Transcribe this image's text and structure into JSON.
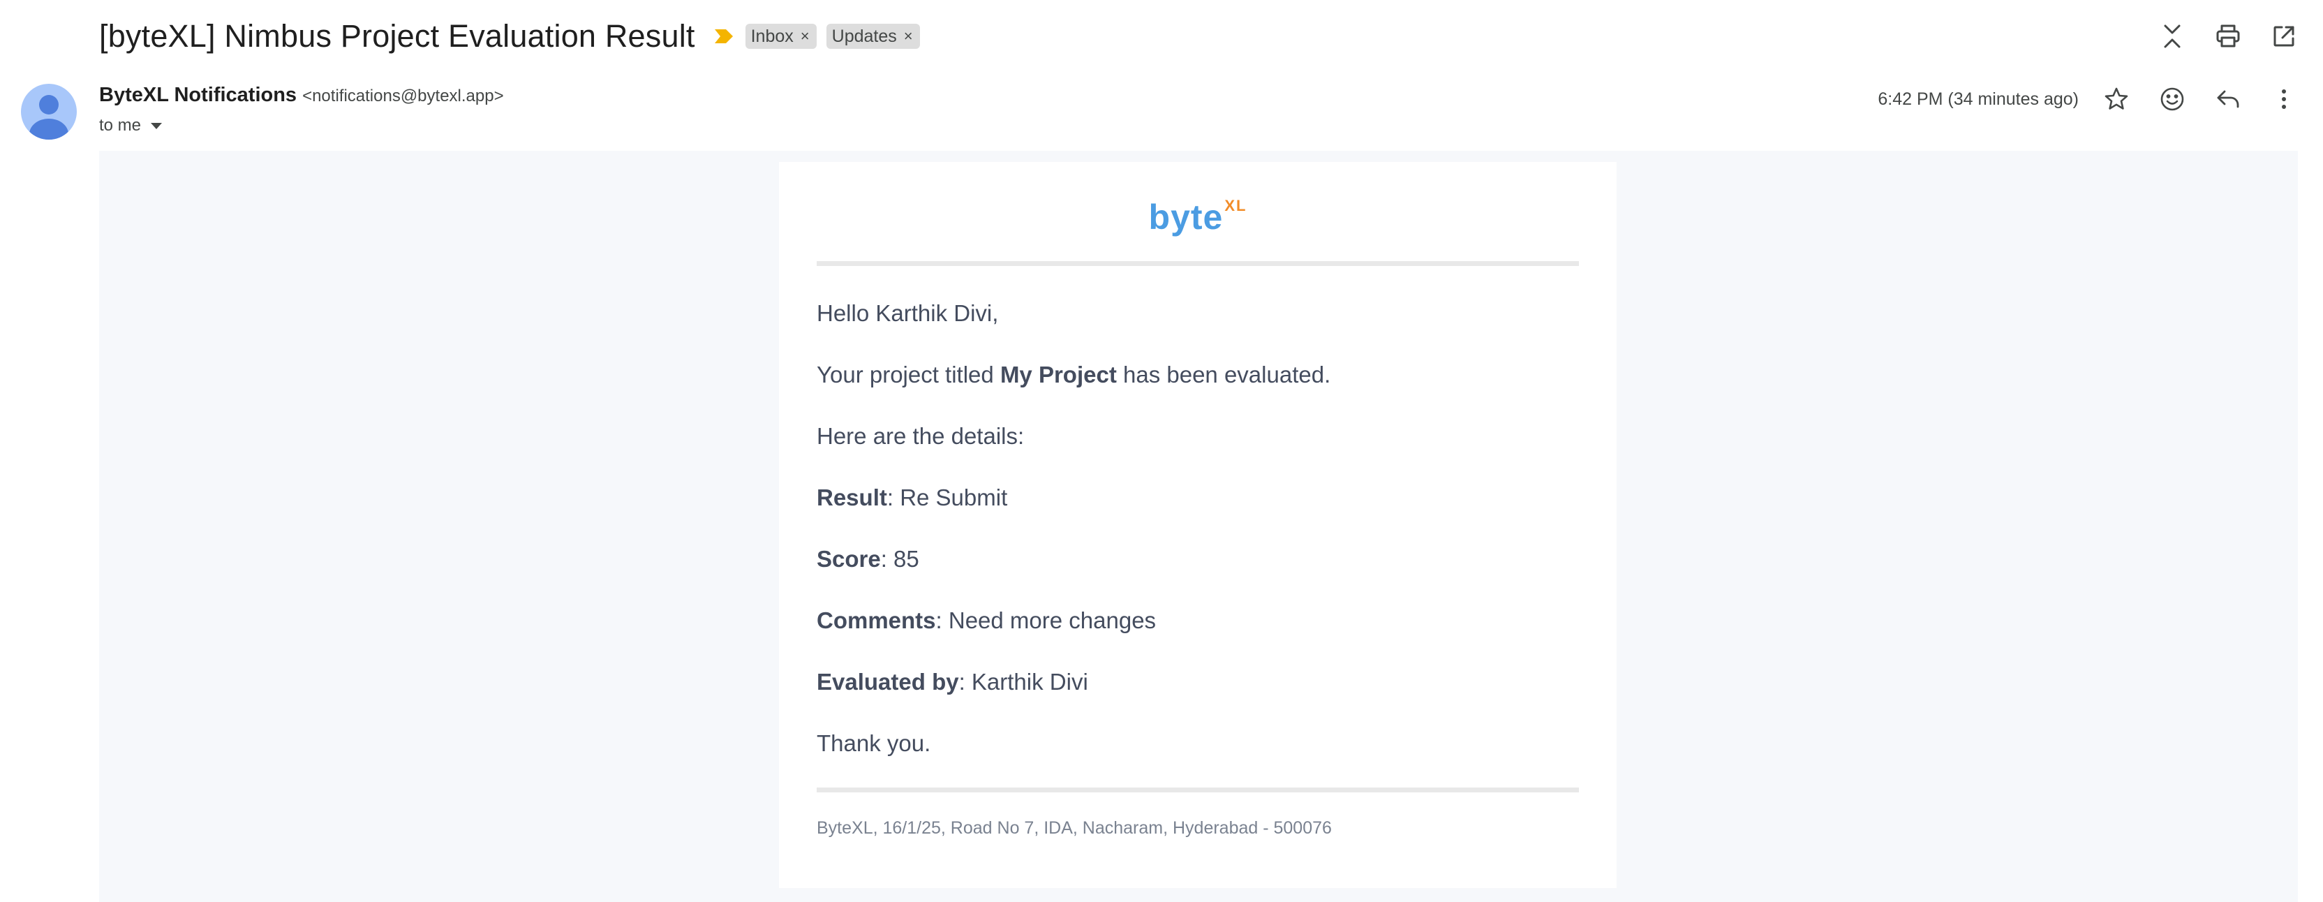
{
  "subject": "[byteXL] Nimbus Project Evaluation Result",
  "labels": [
    {
      "name": "Inbox",
      "remove": "×"
    },
    {
      "name": "Updates",
      "remove": "×"
    }
  ],
  "sender": {
    "name": "ByteXL Notifications",
    "email": "<notifications@bytexl.app>",
    "recipient": "to me"
  },
  "timestamp": "6:42 PM (34 minutes ago)",
  "icons": {
    "importance": "importance-marker-icon",
    "collapse": "collapse-all-icon",
    "print": "print-icon",
    "open_new": "open-in-new-window-icon",
    "star": "star-icon",
    "emoji": "emoji-react-icon",
    "reply": "reply-icon",
    "more": "more-vert-icon"
  },
  "colors": {
    "importance": "#f4b400",
    "logo_blue": "#4b9ce2",
    "logo_orange": "#f28c28",
    "body_bg": "#f6f8fb"
  },
  "email": {
    "logo": {
      "main": "byte",
      "super": "XL"
    },
    "greeting": "Hello Karthik Divi,",
    "intro": {
      "before": "Your project titled ",
      "project": "My Project",
      "after": " has been evaluated."
    },
    "details_intro": "Here are the details:",
    "details": [
      {
        "label": "Result",
        "value": ": Re Submit"
      },
      {
        "label": "Score",
        "value": ": 85"
      },
      {
        "label": "Comments",
        "value": ": Need more changes"
      },
      {
        "label": "Evaluated by",
        "value": ": Karthik Divi"
      }
    ],
    "closing": "Thank you.",
    "footer": "ByteXL, 16/1/25, Road No 7, IDA, Nacharam, Hyderabad - 500076"
  }
}
